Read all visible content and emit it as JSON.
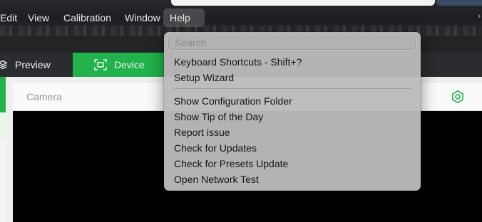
{
  "menubar": {
    "items": [
      "Edit",
      "View",
      "Calibration",
      "Window",
      "Help"
    ],
    "active": "Help"
  },
  "tabs": {
    "preview_label": "Preview",
    "device_label": "Device"
  },
  "camera": {
    "title": "Camera"
  },
  "help_menu": {
    "search_placeholder": "Search",
    "items_group1": [
      "Keyboard Shortcuts -  Shift+?",
      "Setup Wizard"
    ],
    "items_group2": [
      "Show Configuration Folder",
      "Show Tip of the Day",
      "Report issue",
      "Check for Updates",
      "Check for Presets Update",
      "Open Network Test"
    ]
  },
  "colors": {
    "accent_green": "#21b24b",
    "menu_background": "#bababa"
  },
  "icons": {
    "preview": "layers-icon",
    "device": "device-scan-icon",
    "camera_settings": "hexagon-gear-icon"
  }
}
